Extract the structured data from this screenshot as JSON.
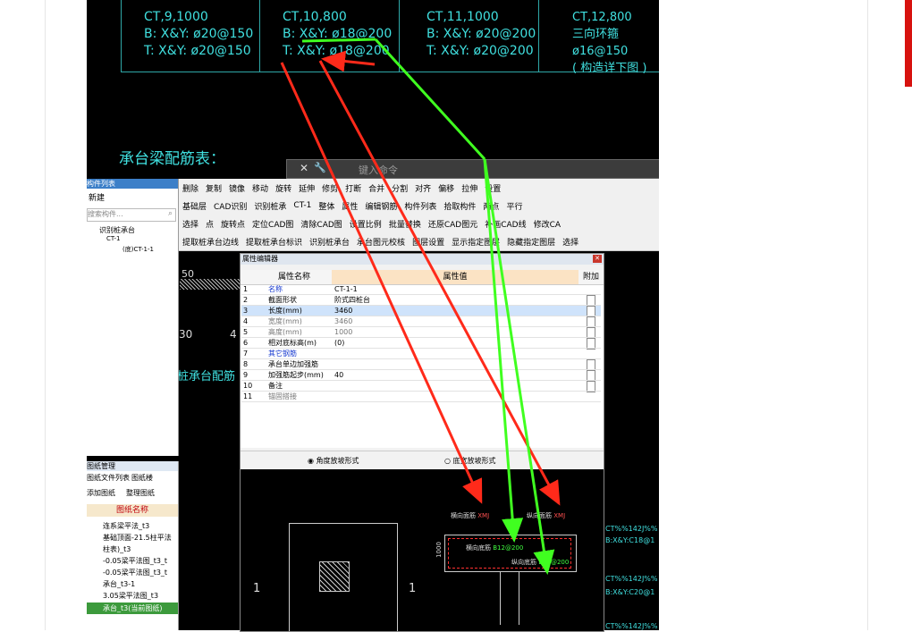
{
  "cad_top": {
    "cells": [
      {
        "id": "CT,9,1000",
        "bottom": "B: X&Y: ø20@150",
        "top": "T: X&Y: ø20@150"
      },
      {
        "id": "CT,10,800",
        "bottom": "B: X&Y: ø18@200",
        "top": "T: X&Y: ø18@200"
      },
      {
        "id": "CT,11,1000",
        "bottom": "B: X&Y: ø20@200",
        "top": "T: X&Y: ø20@200"
      },
      {
        "id": "CT,12,800",
        "bottom": "三向环箍ø16@150",
        "top": "( 构造详下图 )"
      }
    ],
    "section_title": "承台梁配筋表："
  },
  "command_bar": {
    "placeholder": "键入命令"
  },
  "component_panel": {
    "title": "构件列表",
    "new_label": "新建",
    "search_placeholder": "搜索构件...",
    "tree": [
      "识别桩承台",
      "CT-1",
      "(底)CT-1-1"
    ]
  },
  "toolbar": {
    "row1": [
      "删除",
      "复制",
      "镜像",
      "移动",
      "旋转",
      "延伸",
      "修剪",
      "打断",
      "合并",
      "分割",
      "对齐",
      "偏移",
      "拉伸",
      "设置"
    ],
    "row2": [
      "基础层",
      "CAD识别",
      "识别桩承",
      "CT-1",
      "整体",
      "属性",
      "编辑钢筋",
      "构件列表",
      "拾取构件",
      "两点",
      "平行"
    ],
    "row3": [
      "选择",
      "点",
      "旋转点",
      "定位CAD图",
      "清除CAD图",
      "设置比例",
      "批量替换",
      "还原CAD图元",
      "补画CAD线",
      "修改CA"
    ],
    "row4": [
      "提取桩承台边线",
      "提取桩承台标识",
      "识别桩承台",
      "承台图元校核",
      "图层设置",
      "显示指定图层",
      "隐藏指定图层",
      "选择"
    ]
  },
  "prop_editor": {
    "title": "属性编辑器",
    "headers": [
      "属性名称",
      "属性值",
      "附加"
    ],
    "rows": [
      {
        "n": "1",
        "name": "名称",
        "value": "CT-1-1",
        "cb": false
      },
      {
        "n": "2",
        "name": "截面形状",
        "value": "阶式四桩台",
        "cb": true
      },
      {
        "n": "3",
        "name": "长度(mm)",
        "value": "3460",
        "cb": true
      },
      {
        "n": "4",
        "name": "宽度(mm)",
        "value": "3460",
        "cb": true
      },
      {
        "n": "5",
        "name": "高度(mm)",
        "value": "1000",
        "cb": true
      },
      {
        "n": "6",
        "name": "相对底标高(m)",
        "value": "(0)",
        "cb": true
      },
      {
        "n": "7",
        "name": "其它钢筋",
        "value": "",
        "cb": false
      },
      {
        "n": "8",
        "name": "承台单边加强筋",
        "value": "",
        "cb": true
      },
      {
        "n": "9",
        "name": "加强筋起步(mm)",
        "value": "40",
        "cb": true
      },
      {
        "n": "10",
        "name": "备注",
        "value": "",
        "cb": true
      },
      {
        "n": "11",
        "name": "锚固搭接",
        "value": "",
        "cb": false
      }
    ],
    "radio1": "角度放坡形式",
    "radio2": "底宽放坡形式"
  },
  "diagram": {
    "lbl_top_h": "横向面筋",
    "lbl_top_v": "纵向面筋",
    "lbl_bot_h": "横向底筋",
    "lbl_bot_v": "纵向底筋",
    "b_code": "B12@200",
    "t_code": "XMJ",
    "dim": "1000",
    "section_mark": "1"
  },
  "drawing_panel": {
    "title": "图纸管理",
    "tabs": [
      "图纸文件列表",
      "图纸楼"
    ],
    "buttons": [
      "添加图纸",
      "整理图纸"
    ],
    "col": "图纸名称",
    "files": [
      "连系梁平法_t3",
      "基础顶面-21.5柱平法",
      "柱表)_t3",
      "-0.05梁平法图_t3_t",
      "-0.05梁平法图_t3_t",
      "承台_t3-1",
      "3.05梁平法图_t3",
      "承台_t3(当前图纸)"
    ]
  },
  "left_cad": {
    "t1": "50",
    "t2": "30",
    "t3": "4",
    "t4": "桩承台配筋"
  },
  "right_cad": [
    "CT%%142J%%",
    "B:X&Y:C18@1",
    "CT%%142J%%",
    "B:X&Y:C20@1",
    "CT%%142J%%"
  ]
}
